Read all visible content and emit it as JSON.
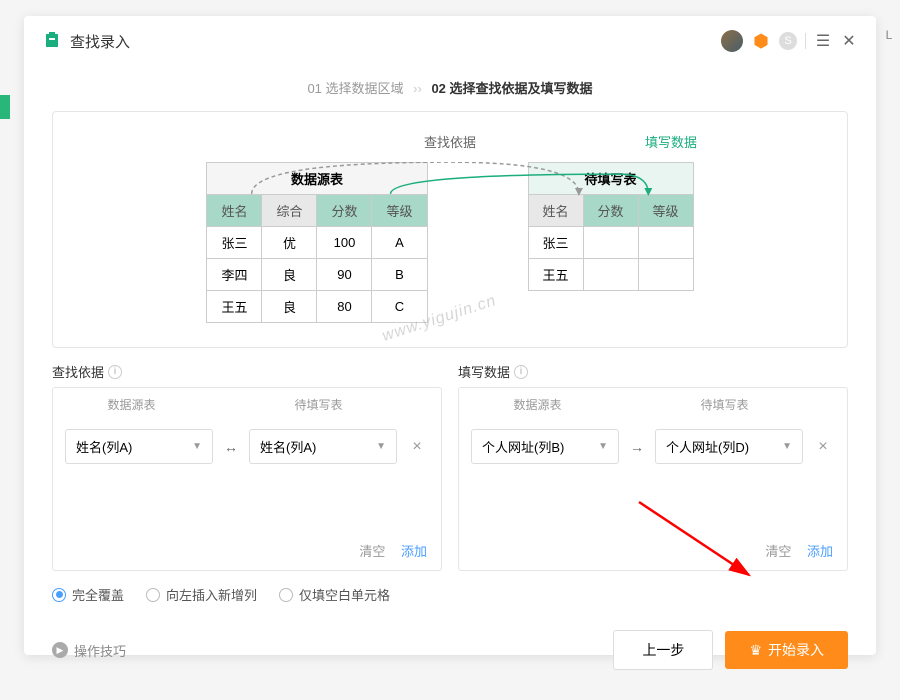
{
  "header": {
    "title": "查找录入"
  },
  "steps": {
    "step1": "01 选择数据区域",
    "step2": "02 选择查找依据及填写数据"
  },
  "diagram": {
    "label_lookup": "查找依据",
    "label_fill": "填写数据",
    "source_table": {
      "title": "数据源表",
      "headers": [
        "姓名",
        "综合",
        "分数",
        "等级"
      ],
      "rows": [
        [
          "张三",
          "优",
          "100",
          "A"
        ],
        [
          "李四",
          "良",
          "90",
          "B"
        ],
        [
          "王五",
          "良",
          "80",
          "C"
        ]
      ]
    },
    "target_table": {
      "title": "待填写表",
      "headers": [
        "姓名",
        "分数",
        "等级"
      ],
      "rows": [
        [
          "张三",
          "",
          ""
        ],
        [
          "王五",
          "",
          ""
        ]
      ]
    }
  },
  "sections": {
    "left": {
      "label": "查找依据",
      "src_header": "数据源表",
      "dst_header": "待填写表",
      "src_value": "姓名(列A)",
      "dst_value": "姓名(列A)",
      "arrow": "↔",
      "clear": "清空",
      "add": "添加"
    },
    "right": {
      "label": "填写数据",
      "src_header": "数据源表",
      "dst_header": "待填写表",
      "src_value": "个人网址(列B)",
      "dst_value": "个人网址(列D)",
      "arrow": "→",
      "clear": "清空",
      "add": "添加"
    }
  },
  "radios": {
    "opt1": "完全覆盖",
    "opt2": "向左插入新增列",
    "opt3": "仅填空白单元格"
  },
  "footer": {
    "tips": "操作技巧",
    "prev": "上一步",
    "start": "开始录入"
  },
  "bg": {
    "colL": "L"
  },
  "watermark": "www.yigujin.cn"
}
